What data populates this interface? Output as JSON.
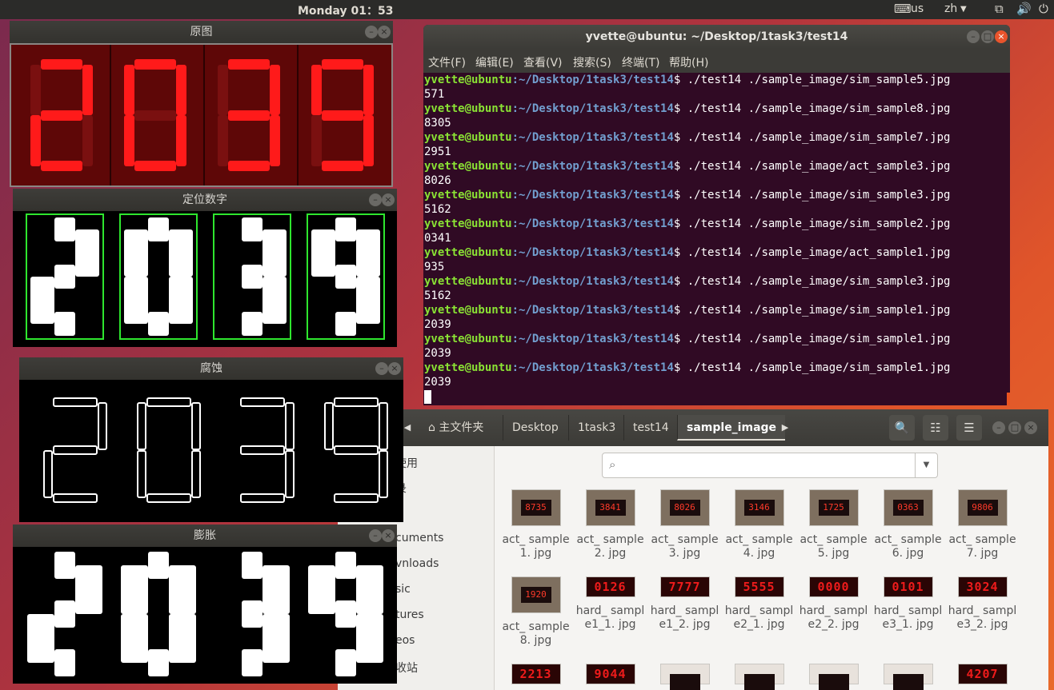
{
  "topbar": {
    "clock": "Monday 01：53",
    "keyboard": "us",
    "language": "zh"
  },
  "windows": {
    "original": {
      "title": "原图",
      "digits": [
        "2",
        "0",
        "3",
        "9"
      ]
    },
    "located": {
      "title": "定位数字",
      "digits": [
        "2",
        "0",
        "3",
        "9"
      ]
    },
    "eroded": {
      "title": "腐蚀",
      "digits": [
        "2",
        "0",
        "3",
        "9"
      ]
    },
    "dilated": {
      "title": "膨胀",
      "digits": [
        "2",
        "0",
        "3",
        "9"
      ]
    }
  },
  "terminal": {
    "title": "yvette@ubuntu: ~/Desktop/1task3/test14",
    "menu": [
      "文件(F)",
      "编辑(E)",
      "查看(V)",
      "搜索(S)",
      "终端(T)",
      "帮助(H)"
    ],
    "prompt_user": "yvette@ubuntu",
    "prompt_path": ":~/Desktop/1task3/test14",
    "prompt_sign": "$ ",
    "commands": [
      {
        "cmd": "./test14 ./sample_image/sim_sample5.jpg",
        "out": "571"
      },
      {
        "cmd": "./test14 ./sample_image/sim_sample8.jpg",
        "out": "8305"
      },
      {
        "cmd": "./test14 ./sample_image/sim_sample7.jpg",
        "out": "2951"
      },
      {
        "cmd": "./test14 ./sample_image/act_sample3.jpg",
        "out": "8026"
      },
      {
        "cmd": "./test14 ./sample_image/sim_sample3.jpg",
        "out": "5162"
      },
      {
        "cmd": "./test14 ./sample_image/sim_sample2.jpg",
        "out": "0341"
      },
      {
        "cmd": "./test14 ./sample_image/act_sample1.jpg",
        "out": "935"
      },
      {
        "cmd": "./test14 ./sample_image/sim_sample3.jpg",
        "out": "5162"
      },
      {
        "cmd": "./test14 ./sample_image/sim_sample1.jpg",
        "out": "2039"
      },
      {
        "cmd": "./test14 ./sample_image/sim_sample1.jpg",
        "out": "2039"
      },
      {
        "cmd": "./test14 ./sample_image/sim_sample1.jpg",
        "out": "2039"
      }
    ]
  },
  "filemanager": {
    "breadcrumbs": [
      "主文件夹",
      "Desktop",
      "1task3",
      "test14",
      "sample_image"
    ],
    "search_placeholder": "",
    "sidebar": [
      "使用",
      "录",
      "cuments",
      "vnloads",
      "sic",
      "tures",
      "eos",
      "收站"
    ],
    "files": [
      {
        "name": "act_ sample1. jpg",
        "lcd": "8735"
      },
      {
        "name": "act_ sample2. jpg",
        "lcd": "3841"
      },
      {
        "name": "act_ sample3. jpg",
        "lcd": "8026"
      },
      {
        "name": "act_ sample4. jpg",
        "lcd": "3146"
      },
      {
        "name": "act_ sample5. jpg",
        "lcd": "1725"
      },
      {
        "name": "act_ sample6. jpg",
        "lcd": "0363"
      },
      {
        "name": "act_ sample7. jpg",
        "lcd": "9806"
      },
      {
        "name": "act_ sample8. jpg",
        "lcd": "1920"
      },
      {
        "name": "hard_ sample1_1. jpg",
        "lcd": "0126"
      },
      {
        "name": "hard_ sample1_2. jpg",
        "lcd": "7777"
      },
      {
        "name": "hard_ sample2_1. jpg",
        "lcd": "5555"
      },
      {
        "name": "hard_ sample2_2. jpg",
        "lcd": "0000"
      },
      {
        "name": "hard_ sample3_1. jpg",
        "lcd": "0101"
      },
      {
        "name": "hard_ sample3_2. jpg",
        "lcd": "3024"
      },
      {
        "name": "",
        "lcd": "2213"
      },
      {
        "name": "",
        "lcd": "9044"
      },
      {
        "name": "",
        "lcd": ""
      },
      {
        "name": "",
        "lcd": ""
      },
      {
        "name": "",
        "lcd": ""
      },
      {
        "name": "",
        "lcd": ""
      },
      {
        "name": "",
        "lcd": "4207"
      }
    ]
  },
  "colors": {
    "terminal_bg": "#300a24",
    "prompt_user": "#8ae234",
    "prompt_path": "#729fcf",
    "led_red": "#ff1a1a",
    "box_green": "#2ee62e"
  }
}
